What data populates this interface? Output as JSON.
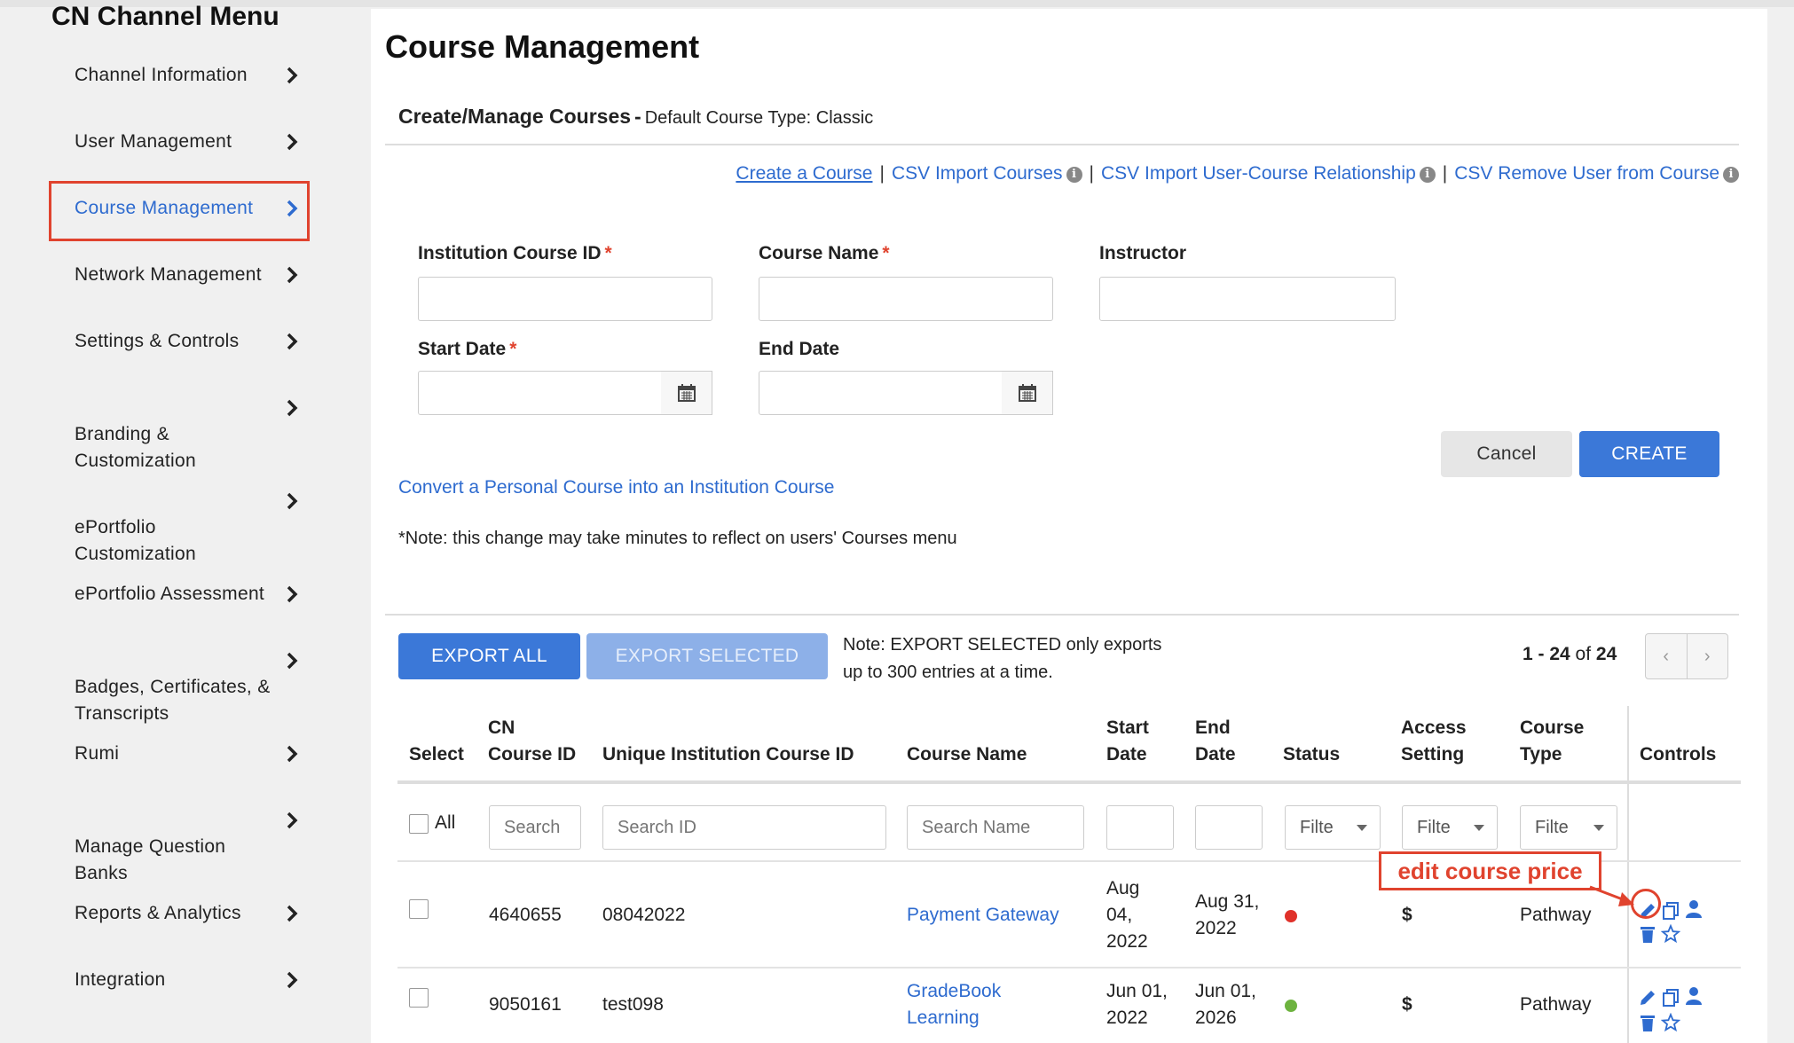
{
  "sidebar": {
    "title": "CN Channel Menu",
    "items": [
      {
        "label": "Channel Information"
      },
      {
        "label": "User Management"
      },
      {
        "label": "Course Management"
      },
      {
        "label": "Network Management"
      },
      {
        "label": "Settings & Controls"
      },
      {
        "label": "Branding &\nCustomization"
      },
      {
        "label": "ePortfolio\nCustomization"
      },
      {
        "label": "ePortfolio Assessment"
      },
      {
        "label": "Badges, Certificates, &\nTranscripts"
      },
      {
        "label": "Rumi"
      },
      {
        "label": "Manage Question\nBanks"
      },
      {
        "label": "Reports & Analytics"
      },
      {
        "label": "Integration"
      }
    ]
  },
  "main": {
    "title": "Course Management",
    "subtitle_bold": "Create/Manage Courses",
    "subtitle_dash": "-",
    "subtitle_rest": "Default Course Type: Classic",
    "links": {
      "create": "Create a Course",
      "csv_import": "CSV Import Courses",
      "csv_relationship": "CSV Import User-Course Relationship",
      "csv_remove": "CSV Remove User from Course",
      "separator": "|",
      "info_glyph": "i"
    },
    "form": {
      "institution_course_id": "Institution Course ID",
      "course_name": "Course Name",
      "instructor": "Instructor",
      "start_date": "Start Date",
      "end_date": "End Date",
      "required_mark": "*",
      "cancel": "Cancel",
      "create": "CREATE"
    },
    "convert_link": "Convert a Personal Course into an Institution Course",
    "note": "*Note: this change may take minutes to reflect on users' Courses menu",
    "export": {
      "all": "EXPORT ALL",
      "selected": "EXPORT SELECTED",
      "note_line1": "Note: EXPORT SELECTED only exports",
      "note_line2": "up to 300 entries at a time."
    },
    "pager": {
      "range": "1 - 24",
      "of": "of",
      "total": "24",
      "prev": "‹",
      "next": "›"
    }
  },
  "table": {
    "headers": {
      "select": "Select",
      "cn_course_id_1": "CN",
      "cn_course_id_2": "Course ID",
      "unique_id": "Unique Institution Course ID",
      "course_name": "Course Name",
      "start_1": "Start",
      "start_2": "Date",
      "end_1": "End",
      "end_2": "Date",
      "status": "Status",
      "access_1": "Access",
      "access_2": "Setting",
      "type_1": "Course",
      "type_2": "Type",
      "controls": "Controls"
    },
    "filters": {
      "all_label": "All",
      "search_placeholder": "Search",
      "search_id": "Search ID",
      "search_name": "Search Name",
      "filter": "Filte"
    },
    "rows": [
      {
        "cn_id": "4640655",
        "unique_id": "08042022",
        "name_1": "Payment Gateway",
        "name_2": "",
        "start_1": "Aug",
        "start_2": "04,",
        "start_3": "2022",
        "end_1": "Aug 31,",
        "end_2": "2022",
        "status_color": "#e0312a",
        "access": "$",
        "type": "Pathway"
      },
      {
        "cn_id": "9050161",
        "unique_id": "test098",
        "name_1": "GradeBook",
        "name_2": "Learning",
        "start_1": "Jun 01,",
        "start_2": "2022",
        "start_3": "",
        "end_1": "Jun 01,",
        "end_2": "2026",
        "status_color": "#6db33f",
        "access": "$",
        "type": "Pathway"
      }
    ]
  },
  "annotation": {
    "label": "edit course price"
  },
  "colors": {
    "accent": "#3b78d8",
    "link": "#2e6bcf",
    "annotation": "#e0432e"
  }
}
